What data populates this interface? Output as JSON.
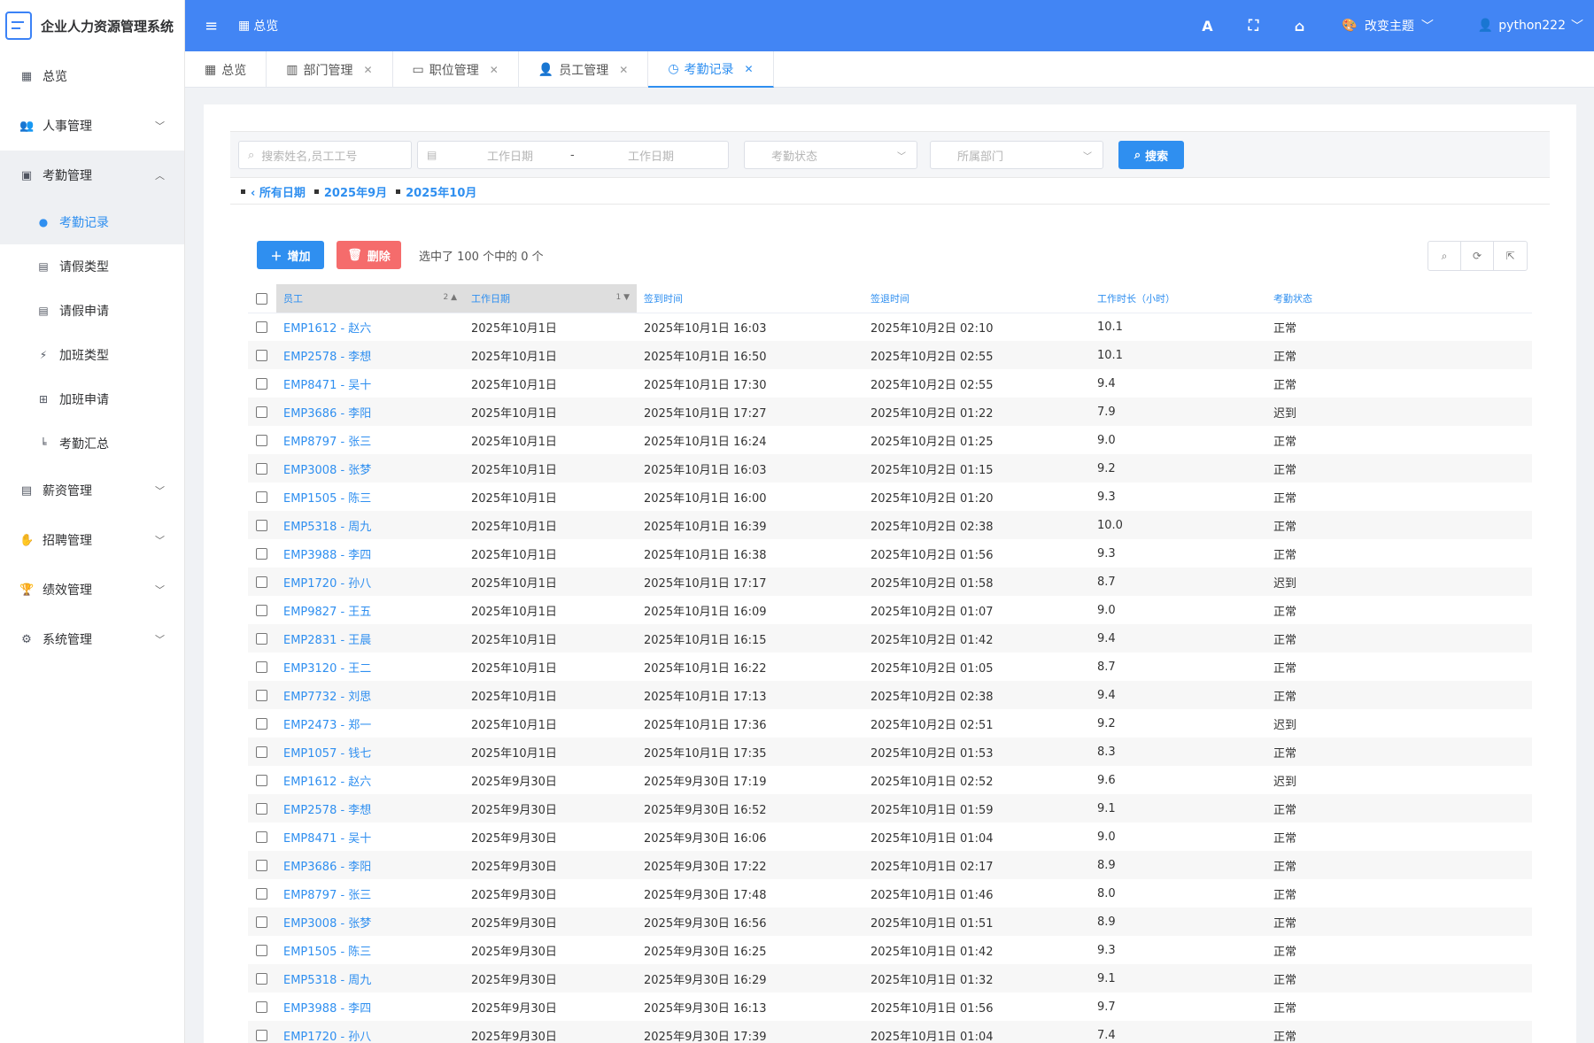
{
  "app": {
    "title": "企业人力资源管理系统"
  },
  "sidebar": {
    "items": [
      {
        "label": "总览",
        "icon": "dashboard-icon"
      },
      {
        "label": "人事管理",
        "icon": "users-icon"
      },
      {
        "label": "考勤管理",
        "icon": "calendar-check-icon"
      },
      {
        "label": "薪资管理",
        "icon": "salary-icon"
      },
      {
        "label": "招聘管理",
        "icon": "handshake-icon"
      },
      {
        "label": "绩效管理",
        "icon": "trophy-icon"
      },
      {
        "label": "系统管理",
        "icon": "cogs-icon"
      }
    ],
    "subitems": [
      {
        "label": "考勤记录",
        "icon": "clock-icon"
      },
      {
        "label": "请假类型",
        "icon": "calendar-icon"
      },
      {
        "label": "请假申请",
        "icon": "calendar-minus-icon"
      },
      {
        "label": "加班类型",
        "icon": "bolt-icon"
      },
      {
        "label": "加班申请",
        "icon": "plus-square-icon"
      },
      {
        "label": "考勤汇总",
        "icon": "chart-icon"
      }
    ]
  },
  "header": {
    "breadcrumb": "总览",
    "theme_label": "改变主题",
    "username": "python222"
  },
  "tabs": [
    {
      "label": "总览"
    },
    {
      "label": "部门管理"
    },
    {
      "label": "职位管理"
    },
    {
      "label": "员工管理"
    },
    {
      "label": "考勤记录"
    }
  ],
  "filters": {
    "search_placeholder": "搜索姓名,员工工号",
    "date_start_placeholder": "工作日期",
    "date_sep": "-",
    "date_end_placeholder": "工作日期",
    "status_placeholder": "考勤状态",
    "dept_placeholder": "所属部门",
    "search_button": "搜索"
  },
  "date_hierarchy": {
    "all": "‹ 所有日期",
    "links": [
      "2025年9月",
      "2025年10月"
    ]
  },
  "actions": {
    "add_label": "增加",
    "delete_label": "删除",
    "selection_info": "选中了 100 个中的 0 个"
  },
  "table": {
    "columns": {
      "employee": "员工",
      "employee_sort_index": "2",
      "work_date": "工作日期",
      "work_date_sort_index": "1",
      "check_in": "签到时间",
      "check_out": "签退时间",
      "hours": "工作时长（小时）",
      "status": "考勤状态"
    },
    "rows": [
      {
        "employee": "EMP1612 - 赵六",
        "date": "2025年10月1日",
        "in": "2025年10月1日 16:03",
        "out": "2025年10月2日 02:10",
        "hours": "10.1",
        "status": "正常"
      },
      {
        "employee": "EMP2578 - 李想",
        "date": "2025年10月1日",
        "in": "2025年10月1日 16:50",
        "out": "2025年10月2日 02:55",
        "hours": "10.1",
        "status": "正常"
      },
      {
        "employee": "EMP8471 - 吴十",
        "date": "2025年10月1日",
        "in": "2025年10月1日 17:30",
        "out": "2025年10月2日 02:55",
        "hours": "9.4",
        "status": "正常"
      },
      {
        "employee": "EMP3686 - 李阳",
        "date": "2025年10月1日",
        "in": "2025年10月1日 17:27",
        "out": "2025年10月2日 01:22",
        "hours": "7.9",
        "status": "迟到"
      },
      {
        "employee": "EMP8797 - 张三",
        "date": "2025年10月1日",
        "in": "2025年10月1日 16:24",
        "out": "2025年10月2日 01:25",
        "hours": "9.0",
        "status": "正常"
      },
      {
        "employee": "EMP3008 - 张梦",
        "date": "2025年10月1日",
        "in": "2025年10月1日 16:03",
        "out": "2025年10月2日 01:15",
        "hours": "9.2",
        "status": "正常"
      },
      {
        "employee": "EMP1505 - 陈三",
        "date": "2025年10月1日",
        "in": "2025年10月1日 16:00",
        "out": "2025年10月2日 01:20",
        "hours": "9.3",
        "status": "正常"
      },
      {
        "employee": "EMP5318 - 周九",
        "date": "2025年10月1日",
        "in": "2025年10月1日 16:39",
        "out": "2025年10月2日 02:38",
        "hours": "10.0",
        "status": "正常"
      },
      {
        "employee": "EMP3988 - 李四",
        "date": "2025年10月1日",
        "in": "2025年10月1日 16:38",
        "out": "2025年10月2日 01:56",
        "hours": "9.3",
        "status": "正常"
      },
      {
        "employee": "EMP1720 - 孙八",
        "date": "2025年10月1日",
        "in": "2025年10月1日 17:17",
        "out": "2025年10月2日 01:58",
        "hours": "8.7",
        "status": "迟到"
      },
      {
        "employee": "EMP9827 - 王五",
        "date": "2025年10月1日",
        "in": "2025年10月1日 16:09",
        "out": "2025年10月2日 01:07",
        "hours": "9.0",
        "status": "正常"
      },
      {
        "employee": "EMP2831 - 王晨",
        "date": "2025年10月1日",
        "in": "2025年10月1日 16:15",
        "out": "2025年10月2日 01:42",
        "hours": "9.4",
        "status": "正常"
      },
      {
        "employee": "EMP3120 - 王二",
        "date": "2025年10月1日",
        "in": "2025年10月1日 16:22",
        "out": "2025年10月2日 01:05",
        "hours": "8.7",
        "status": "正常"
      },
      {
        "employee": "EMP7732 - 刘思",
        "date": "2025年10月1日",
        "in": "2025年10月1日 17:13",
        "out": "2025年10月2日 02:38",
        "hours": "9.4",
        "status": "正常"
      },
      {
        "employee": "EMP2473 - 郑一",
        "date": "2025年10月1日",
        "in": "2025年10月1日 17:36",
        "out": "2025年10月2日 02:51",
        "hours": "9.2",
        "status": "迟到"
      },
      {
        "employee": "EMP1057 - 钱七",
        "date": "2025年10月1日",
        "in": "2025年10月1日 17:35",
        "out": "2025年10月2日 01:53",
        "hours": "8.3",
        "status": "正常"
      },
      {
        "employee": "EMP1612 - 赵六",
        "date": "2025年9月30日",
        "in": "2025年9月30日 17:19",
        "out": "2025年10月1日 02:52",
        "hours": "9.6",
        "status": "迟到"
      },
      {
        "employee": "EMP2578 - 李想",
        "date": "2025年9月30日",
        "in": "2025年9月30日 16:52",
        "out": "2025年10月1日 01:59",
        "hours": "9.1",
        "status": "正常"
      },
      {
        "employee": "EMP8471 - 吴十",
        "date": "2025年9月30日",
        "in": "2025年9月30日 16:06",
        "out": "2025年10月1日 01:04",
        "hours": "9.0",
        "status": "正常"
      },
      {
        "employee": "EMP3686 - 李阳",
        "date": "2025年9月30日",
        "in": "2025年9月30日 17:22",
        "out": "2025年10月1日 02:17",
        "hours": "8.9",
        "status": "正常"
      },
      {
        "employee": "EMP8797 - 张三",
        "date": "2025年9月30日",
        "in": "2025年9月30日 17:48",
        "out": "2025年10月1日 01:46",
        "hours": "8.0",
        "status": "正常"
      },
      {
        "employee": "EMP3008 - 张梦",
        "date": "2025年9月30日",
        "in": "2025年9月30日 16:56",
        "out": "2025年10月1日 01:51",
        "hours": "8.9",
        "status": "正常"
      },
      {
        "employee": "EMP1505 - 陈三",
        "date": "2025年9月30日",
        "in": "2025年9月30日 16:25",
        "out": "2025年10月1日 01:42",
        "hours": "9.3",
        "status": "正常"
      },
      {
        "employee": "EMP5318 - 周九",
        "date": "2025年9月30日",
        "in": "2025年9月30日 16:29",
        "out": "2025年10月1日 01:32",
        "hours": "9.1",
        "status": "正常"
      },
      {
        "employee": "EMP3988 - 李四",
        "date": "2025年9月30日",
        "in": "2025年9月30日 16:13",
        "out": "2025年10月1日 01:56",
        "hours": "9.7",
        "status": "正常"
      },
      {
        "employee": "EMP1720 - 孙八",
        "date": "2025年9月30日",
        "in": "2025年9月30日 17:39",
        "out": "2025年10月1日 01:04",
        "hours": "7.4",
        "status": "正常"
      }
    ]
  },
  "colors": {
    "primary": "#2f8ff0",
    "header_bg": "#4285f4",
    "danger": "#f56c6c"
  }
}
